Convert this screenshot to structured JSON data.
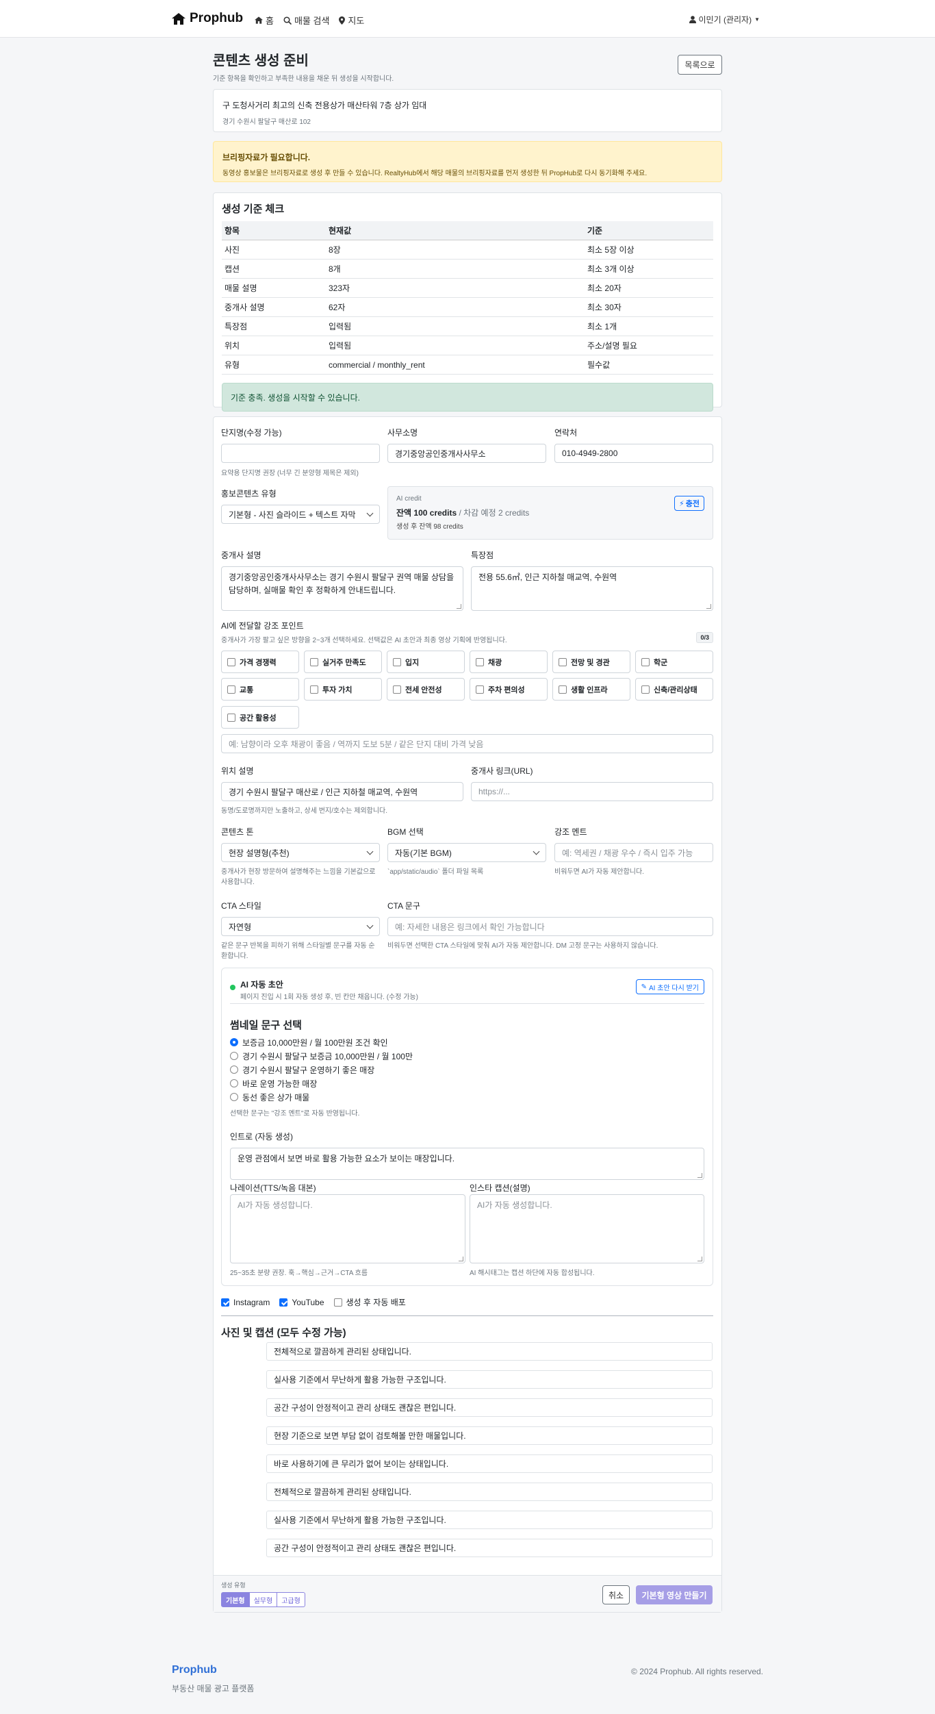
{
  "nav": {
    "brand": "Prophub",
    "home": "홈",
    "search": "매물 검색",
    "map": "지도",
    "user": "이민기 (관리자)"
  },
  "header": {
    "title": "콘텐츠 생성 준비",
    "subtitle": "기준 항목을 확인하고 부족한 내용을 채운 뒤 생성을 시작합니다.",
    "back_button": "목록으로"
  },
  "property": {
    "title": "구 도청사거리 최고의 신축 전용상가 매산타워 7층 상가 임대",
    "address": "경기 수원시 팔달구 매산로 102"
  },
  "alert": {
    "title": "브리핑자료가 필요합니다.",
    "body": "동영상 홍보물은 브리핑자료로 생성 후 만들 수 있습니다. RealtyHub에서 해당 매물의 브리핑자료를 먼저 생성한 뒤 PropHub로 다시 동기화해 주세요."
  },
  "criteria": {
    "title": "생성 기준 체크",
    "headers": [
      "항목",
      "현재값",
      "기준"
    ],
    "rows": [
      [
        "사진",
        "8장",
        "최소 5장 이상"
      ],
      [
        "캡션",
        "8개",
        "최소 3개 이상"
      ],
      [
        "매물 설명",
        "323자",
        "최소 20자"
      ],
      [
        "중개사 설명",
        "62자",
        "최소 30자"
      ],
      [
        "특장점",
        "입력됨",
        "최소 1개"
      ],
      [
        "위치",
        "입력됨",
        "주소/설명 필요"
      ],
      [
        "유형",
        "commercial / monthly_rent",
        "필수값"
      ]
    ],
    "success": "기준 충족. 생성을 시작할 수 있습니다."
  },
  "form": {
    "complex_label": "단지명(수정 가능)",
    "complex_value": "",
    "complex_help": "요약용 단지명 권장 (너무 긴 분양형 제목은 제외)",
    "office_label": "사무소명",
    "office_value": "경기중앙공인중개사사무소",
    "contact_label": "연락처",
    "contact_value": "010-4949-2800",
    "type_label": "홍보콘텐츠 유형",
    "type_value": "기본형 - 사진 슬라이드 + 텍스트 자막",
    "credit": {
      "label": "AI credit",
      "balance_bold": "잔액 100 credits",
      "deduct": " / 차감 예정 2 credits",
      "after": "생성 후 잔액 98 credits",
      "charge": "충전"
    },
    "agent_desc_label": "중개사 설명",
    "agent_desc_value": "경기중앙공인중개사사무소는 경기 수원시 팔달구 권역 매물 상담을 담당하며, 실매물 확인 후 정확하게 안내드립니다.",
    "features_label": "특장점",
    "features_value": "전용 55.6㎡, 인근 지하철 매교역, 수원역",
    "emphasis_label": "AI에 전달할 강조 포인트",
    "emphasis_help": "중개사가 가장 팔고 싶은 방향을 2~3개 선택하세요. 선택값은 AI 초안과 최종 영상 기획에 반영됩니다.",
    "emphasis_count": "0/3",
    "emphasis_options": [
      "가격 경쟁력",
      "실거주 만족도",
      "입지",
      "채광",
      "전망 및 경관",
      "학군",
      "교통",
      "투자 가치",
      "전세 안전성",
      "주차 편의성",
      "생활 인프라",
      "신축/관리상태",
      "공간 활용성"
    ],
    "emphasis_placeholder": "예: 남향이라 오후 채광이 좋음 / 역까지 도보 5분 / 같은 단지 대비 가격 낮음",
    "location_label": "위치 설명",
    "location_value": "경기 수원시 팔달구 매산로 / 인근 지하철 매교역, 수원역",
    "location_help": "동명/도로명까지만 노출하고, 상세 번지/호수는 제외합니다.",
    "link_label": "중개사 링크(URL)",
    "link_placeholder": "https://...",
    "tone_label": "콘텐츠 톤",
    "tone_value": "현장 설명형(추천)",
    "tone_help": "중개사가 현장 방문하여 설명해주는 느낌을 기본값으로 사용합니다.",
    "bgm_label": "BGM 선택",
    "bgm_value": "자동(기본 BGM)",
    "bgm_help": "`app/static/audio` 폴더 파일 목록",
    "hint_label": "강조 멘트",
    "hint_placeholder": "예: 역세권 / 채광 우수 / 즉시 입주 가능",
    "hint_help": "비워두면 AI가 자동 제안합니다.",
    "cta_style_label": "CTA 스타일",
    "cta_style_value": "자연형",
    "cta_style_help": "같은 문구 반복을 피하기 위해 스타일별 문구를 자동 순환합니다.",
    "cta_label": "CTA 문구",
    "cta_placeholder": "예: 자세한 내용은 링크에서 확인 가능합니다",
    "cta_help": "비워두면 선택한 CTA 스타일에 맞춰 AI가 자동 제안합니다. DM 고정 문구는 사용하지 않습니다."
  },
  "ai": {
    "title": "AI 자동 초안",
    "subtitle": "페이지 진입 시 1회 자동 생성 후, 빈 칸만 채웁니다. (수정 가능)",
    "retry": "AI 초안 다시 받기",
    "status_color": "#22c55e",
    "thumb_title": "썸네일 문구 선택",
    "thumb_options": [
      "보증금 10,000만원 / 월 100만원 조건 확인",
      "경기 수원시 팔달구 보증금 10,000만원 / 월 100만",
      "경기 수원시 팔달구 운영하기 좋은 매장",
      "바로 운영 가능한 매장",
      "동선 좋은 상가 매물"
    ],
    "thumb_help": "선택한 문구는 \"강조 멘트\"로 자동 반영됩니다.",
    "intro_label": "인트로 (자동 생성)",
    "intro_value": "운영 관점에서 보면 바로 활용 가능한 요소가 보이는 매장입니다.",
    "narration_label": "나레이션(TTS/녹음 대본)",
    "narration_placeholder": "AI가 자동 생성합니다.",
    "narration_help": "25~35초 분량 권장. 훅→핵심→근거→CTA 흐름",
    "insta_label": "인스타 캡션(설명)",
    "insta_placeholder": "AI가 자동 생성합니다.",
    "insta_help": "AI 해시태그는 캡션 하단에 자동 합성됩니다."
  },
  "platforms": [
    {
      "label": "Instagram",
      "checked": true
    },
    {
      "label": "YouTube",
      "checked": true
    },
    {
      "label": "생성 후 자동 배포",
      "checked": false
    }
  ],
  "photos": {
    "title": "사진 및 캡션 (모두 수정 가능)",
    "captions": [
      "전체적으로 깔끔하게 관리된 상태입니다.",
      "실사용 기준에서 무난하게 활용 가능한 구조입니다.",
      "공간 구성이 안정적이고 관리 상태도 괜찮은 편입니다.",
      "현장 기준으로 보면 부담 없이 검토해볼 만한 매물입니다.",
      "바로 사용하기에 큰 무리가 없어 보이는 상태입니다.",
      "전체적으로 깔끔하게 관리된 상태입니다.",
      "실사용 기준에서 무난하게 활용 가능한 구조입니다.",
      "공간 구성이 안정적이고 관리 상태도 괜찮은 편입니다."
    ]
  },
  "footer_bar": {
    "label": "생성 유형",
    "tabs": [
      "기본형",
      "실무형",
      "고급형"
    ],
    "cancel": "취소",
    "submit": "기본형 영상 만들기"
  },
  "footer": {
    "brand": "Prophub",
    "tagline": "부동산 매물 광고 플랫폼",
    "copyright": "© 2024 Prophub. All rights reserved."
  },
  "colors": {
    "primary": "#0d6efd",
    "brand_link": "#2f6fd6",
    "submit": "#a69ee6",
    "alert_bg": "#fff3cd",
    "success_bg": "#d1e7dd"
  }
}
